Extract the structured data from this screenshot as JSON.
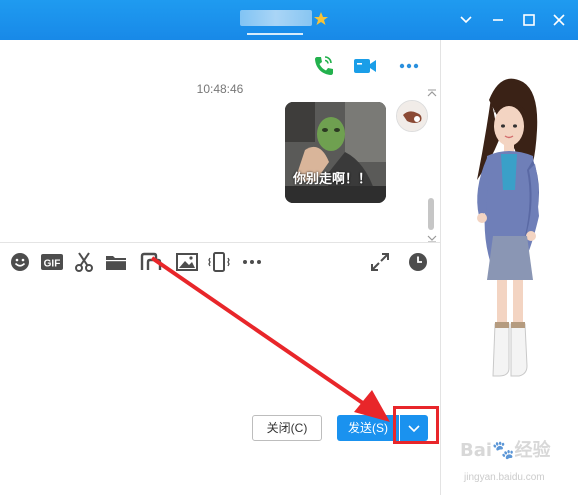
{
  "titlebar": {
    "title_obscured": true,
    "controls": [
      "chevron-down-icon",
      "minimize-icon",
      "maximize-icon",
      "close-icon"
    ]
  },
  "chat": {
    "actions": [
      "phone-call-icon",
      "video-call-icon",
      "more-options-icon"
    ],
    "timestamp": "10:48:46",
    "message_image_caption": "你别走啊！！",
    "colors": {
      "accent": "#1a92ef",
      "call_green": "#23b14d",
      "highlight": "#e8262a"
    }
  },
  "toolbar": {
    "tools": [
      "emoji-icon",
      "gif-icon",
      "screenshot-scissors-icon",
      "folder-icon",
      "dual-screen-icon",
      "image-icon",
      "shake-window-icon",
      "more-tools-icon",
      "expand-icon",
      "history-clock-icon"
    ],
    "gif_label": "GIF"
  },
  "buttons": {
    "close_label": "关闭(C)",
    "send_label": "发送(S)"
  },
  "watermark": {
    "brand": "Bai",
    "brand2": "经验",
    "sub": "jingyan.baidu.com"
  }
}
